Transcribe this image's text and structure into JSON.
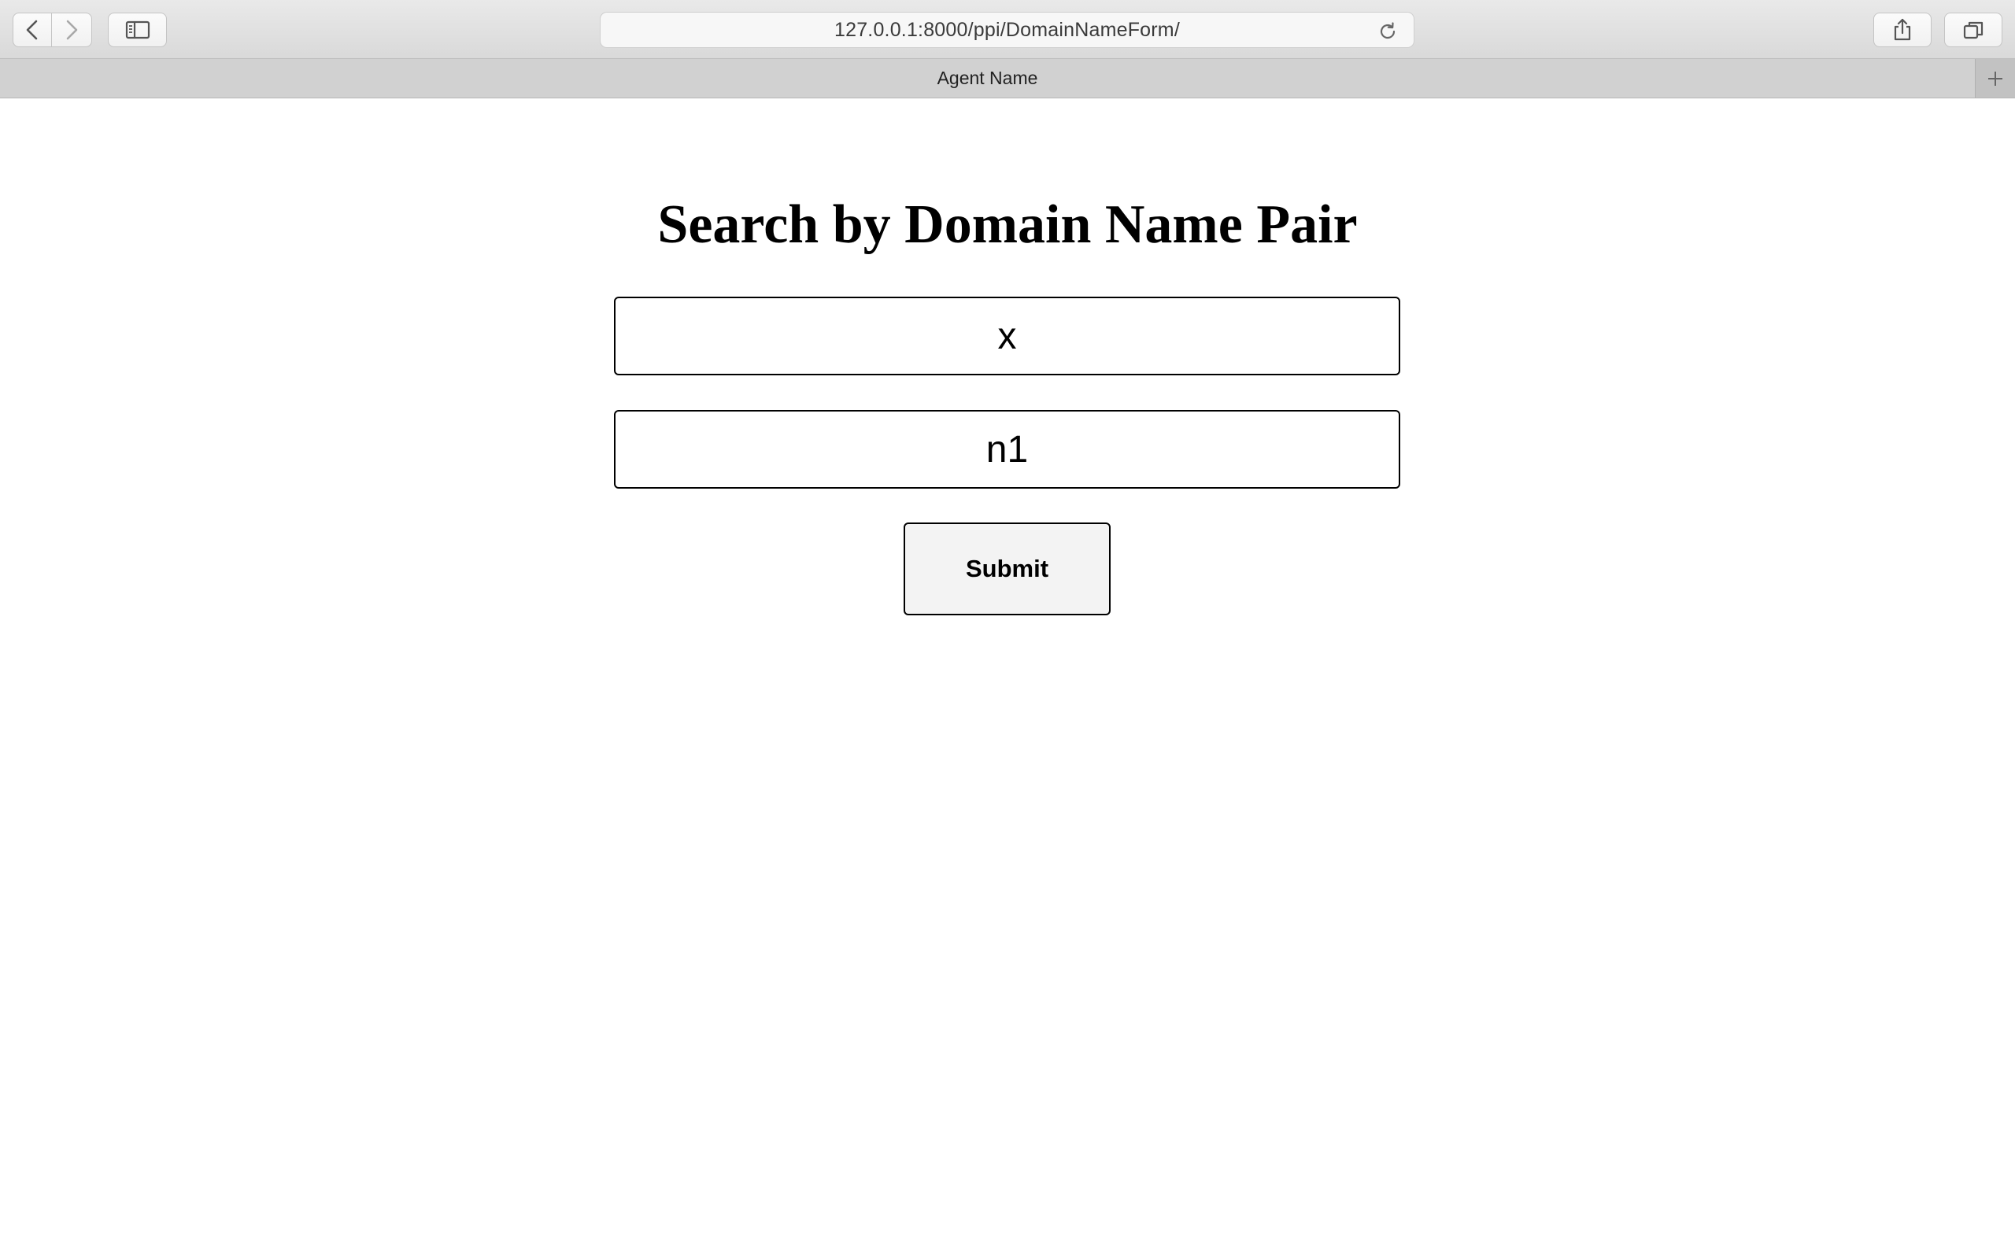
{
  "browser": {
    "url": "127.0.0.1:8000/ppi/DomainNameForm/",
    "tab_title": "Agent Name",
    "icons": {
      "back": "chevron-left-icon",
      "forward": "chevron-right-icon",
      "sidebar": "sidebar-icon",
      "reload": "reload-icon",
      "share": "share-icon",
      "tabs": "tabs-overview-icon",
      "new_tab": "plus-icon"
    }
  },
  "form": {
    "heading": "Search by Domain Name Pair",
    "field1_value": "x",
    "field2_value": "n1",
    "submit_label": "Submit"
  }
}
